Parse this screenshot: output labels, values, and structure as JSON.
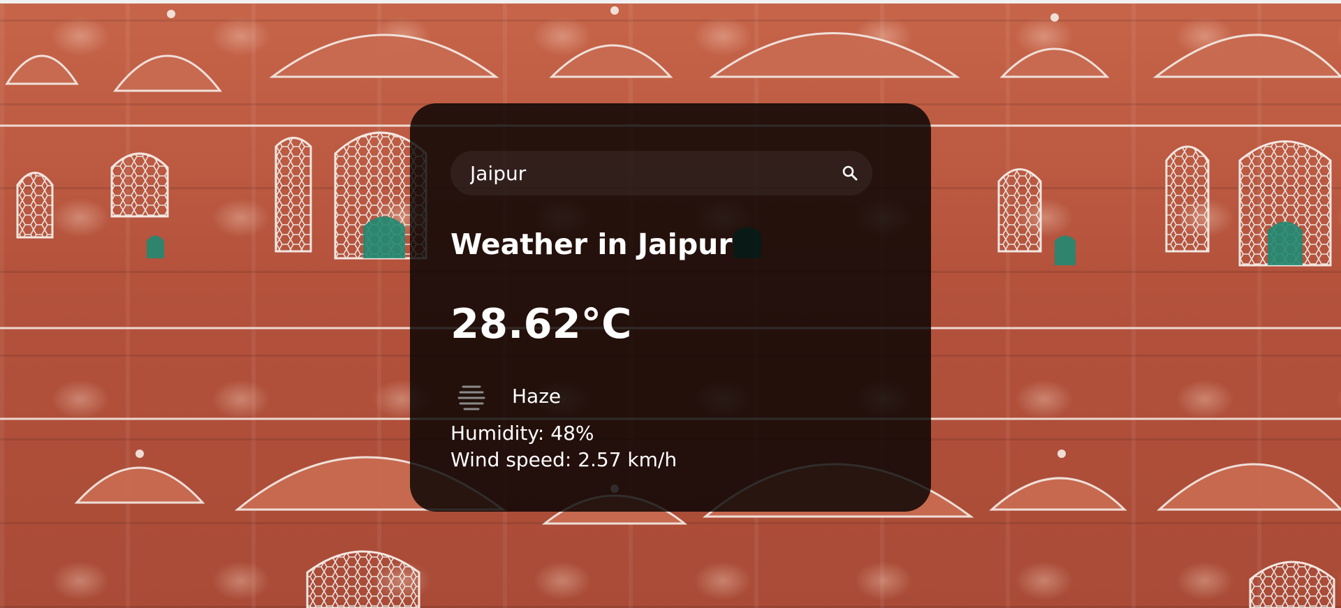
{
  "search": {
    "value": "Jaipur",
    "button_icon": "search-icon"
  },
  "weather": {
    "title": "Weather in Jaipur",
    "temperature": "28.62°C",
    "description": "Haze",
    "description_icon": "haze-icon",
    "humidity": "Humidity: 48%",
    "wind": "Wind speed: 2.57 km/h"
  },
  "colors": {
    "card_background": "rgba(0,0,0,0.80)",
    "text": "#ffffff",
    "background_tone": "#b8573f"
  }
}
